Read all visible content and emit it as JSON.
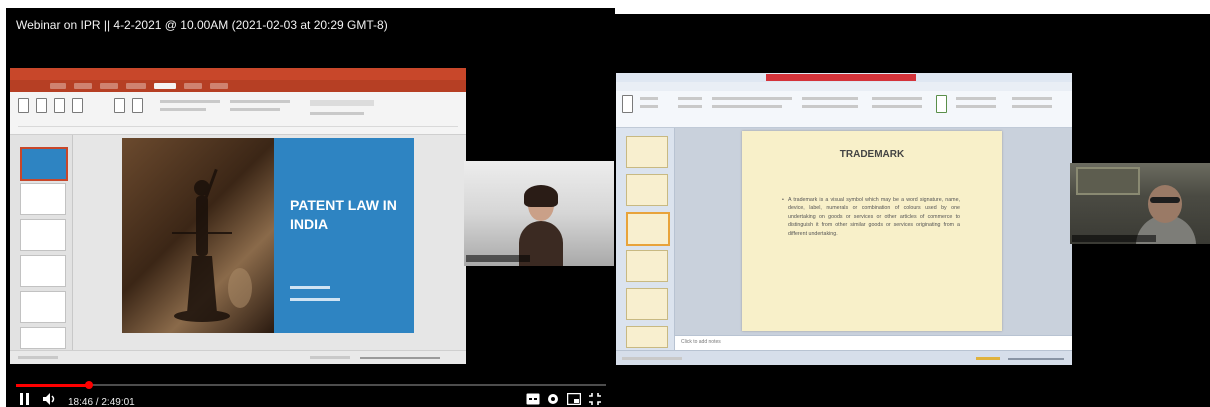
{
  "left_player": {
    "title": "Webinar on IPR || 4-2-2021 @ 10.00AM (2021-02-03 at 20:29 GMT-8)",
    "progress_fraction": 0.124,
    "time": {
      "current": "18:46",
      "duration": "2:49:01",
      "display": "18:46 / 2:49:01"
    },
    "controls": {
      "pause_icon": "pause-icon",
      "volume_icon": "volume-icon",
      "captions_icon": "captions-icon",
      "settings_icon": "gear-icon",
      "miniplayer_icon": "miniplayer-icon",
      "fullscreen_icon": "fullscreen-exit-icon"
    },
    "slide": {
      "title": "PATENT LAW IN INDIA"
    }
  },
  "right_view": {
    "slide": {
      "title": "TRADEMARK",
      "bullet": "A trademark is a visual symbol which may be a word signature, name, device, label, numerals or combination of colours used by one undertaking on goods or services or other articles of commerce to distinguish it from other similar goods or services originating from a different undertaking."
    },
    "notes_placeholder": "Click to add notes"
  },
  "colors": {
    "player_bg": "#000000",
    "progress": "#ff0000",
    "left_ppt_accent": "#c8472a",
    "slide_blue": "#2e84c2",
    "right_slide_bg": "#f8f0c9",
    "right_titlebar_red": "#d4333a"
  }
}
